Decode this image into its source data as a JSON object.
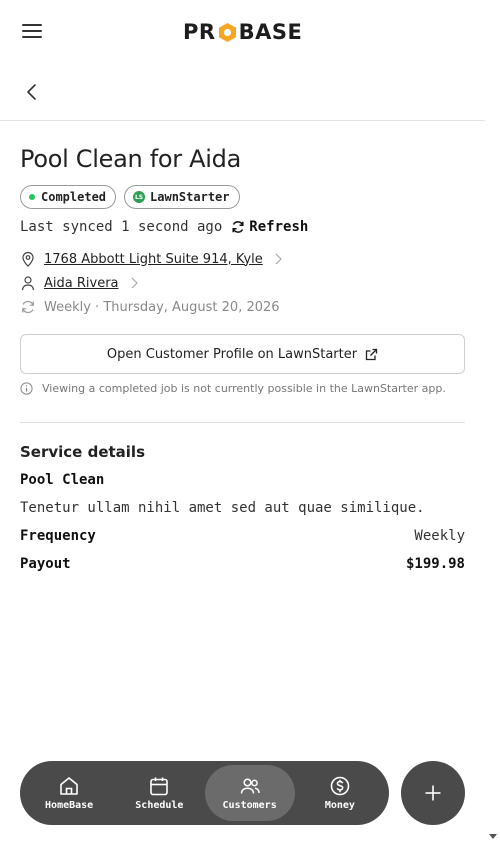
{
  "header": {
    "brand": "PROBASE",
    "brand_left": "PR",
    "brand_right": "BASE",
    "brand_accent": "#F5A623"
  },
  "job": {
    "title": "Pool Clean for Aida",
    "status_badge": "Completed",
    "source_badge": "LawnStarter",
    "last_synced": "Last synced 1 second ago",
    "refresh_label": "Refresh",
    "address": "1768 Abbott Light Suite 914, Kyle",
    "customer": "Aida Rivera",
    "recurrence": "Weekly · Thursday, August 20, 2026",
    "profile_button": "Open Customer Profile on LawnStarter",
    "note": "Viewing a completed job is not currently possible in the LawnStarter app."
  },
  "service": {
    "section_title": "Service details",
    "name": "Pool Clean",
    "description": "Tenetur ullam nihil amet sed aut quae similique.",
    "frequency_label": "Frequency",
    "frequency_value": "Weekly",
    "payout_label": "Payout",
    "payout_value": "$199.98"
  },
  "nav": {
    "items": [
      {
        "label": "HomeBase",
        "icon": "home-icon"
      },
      {
        "label": "Schedule",
        "icon": "calendar-icon"
      },
      {
        "label": "Customers",
        "icon": "users-icon",
        "active": true
      },
      {
        "label": "Money",
        "icon": "dollar-icon"
      }
    ],
    "fab_icon": "plus-icon"
  },
  "colors": {
    "status_green": "#22c55e",
    "nav_bg": "#4a4a4a",
    "nav_active": "#6b6b6b"
  }
}
